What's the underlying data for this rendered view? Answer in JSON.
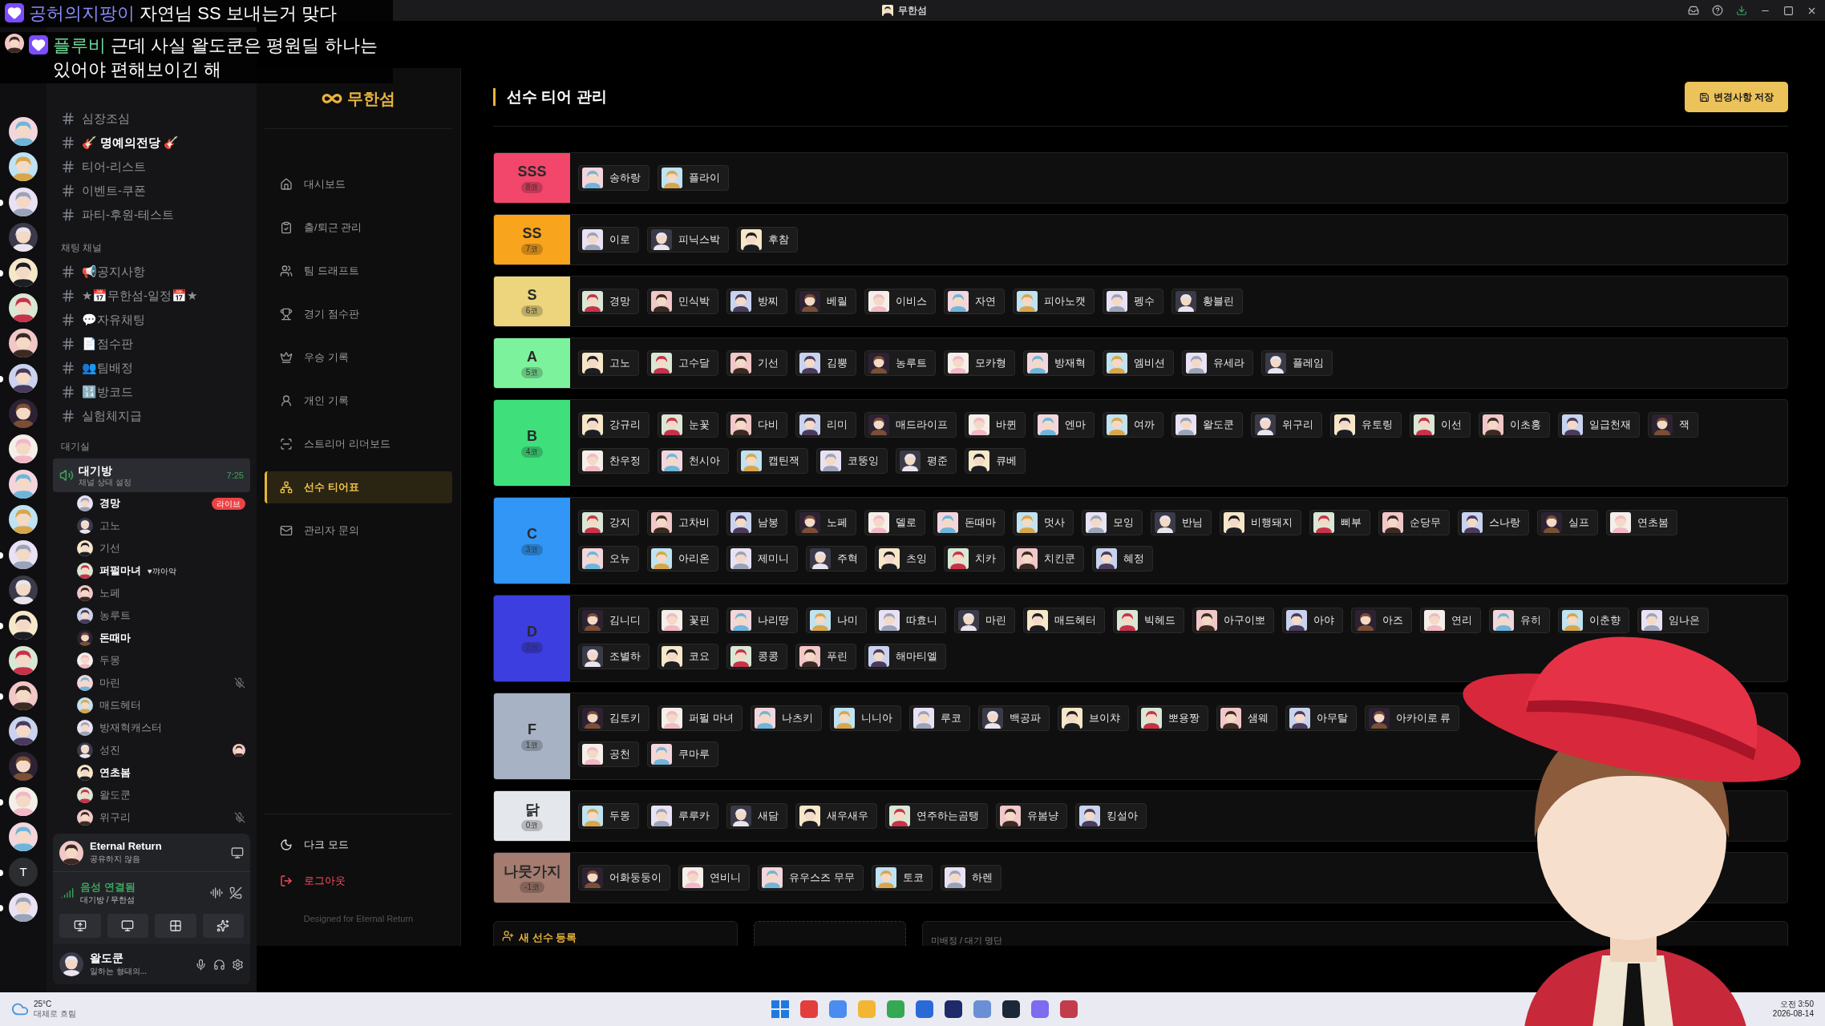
{
  "window": {
    "title": "무한섬"
  },
  "chat_overlay": [
    {
      "user": "공허의지팡이",
      "color": "#8c8cff",
      "text": "자연님 SS 보내는거 맞다",
      "avatar": false
    },
    {
      "user": "플루비",
      "color": "#6fdc9a",
      "text": "근데 사실 왈도쿤은 평원딜 하나는 있어야 편해보이긴 해",
      "avatar": true
    }
  ],
  "servers": [
    {
      "kind": "picture",
      "unread": false
    },
    {
      "kind": "picture",
      "unread": false
    },
    {
      "kind": "picture",
      "unread": true
    },
    {
      "kind": "picture",
      "unread": false
    },
    {
      "kind": "picture",
      "unread": true
    },
    {
      "kind": "picture",
      "unread": false
    },
    {
      "kind": "picture",
      "unread": false
    },
    {
      "kind": "picture",
      "unread": true
    },
    {
      "kind": "picture",
      "unread": false
    },
    {
      "kind": "picture",
      "unread": false
    },
    {
      "kind": "picture",
      "unread": false
    },
    {
      "kind": "picture",
      "unread": false
    },
    {
      "kind": "picture",
      "unread": true
    },
    {
      "kind": "picture",
      "unread": false
    },
    {
      "kind": "picture",
      "unread": true
    },
    {
      "kind": "picture",
      "unread": false
    },
    {
      "kind": "picture",
      "unread": true
    },
    {
      "kind": "picture",
      "unread": false
    },
    {
      "kind": "picture",
      "unread": false
    },
    {
      "kind": "picture",
      "unread": true
    },
    {
      "kind": "picture",
      "unread": false
    },
    {
      "kind": "text",
      "label": "T",
      "unread": true
    },
    {
      "kind": "picture",
      "unread": true
    }
  ],
  "discord": {
    "channels": [
      {
        "name": "심장조심",
        "unread": false
      },
      {
        "name": "🎸 명예의전당 🎸",
        "unread": true
      },
      {
        "name": "티어-리스트",
        "unread": false
      },
      {
        "name": "이벤트-쿠폰",
        "unread": false
      },
      {
        "name": "파티-후원-테스트",
        "unread": false
      }
    ],
    "categories": [
      {
        "name": "채팅 채널",
        "channels": [
          {
            "name": "📢공지사항",
            "unread": false
          },
          {
            "name": "★📅무한섬-일정📅★",
            "unread": false
          },
          {
            "name": "💬자유채팅",
            "unread": false
          },
          {
            "name": "📄점수판",
            "unread": false
          },
          {
            "name": "👥팀배정",
            "unread": false
          },
          {
            "name": "🔢방코드",
            "unread": false
          },
          {
            "name": "실험체지급",
            "unread": false
          }
        ]
      }
    ],
    "voice_category": "대기실",
    "voice_channel": {
      "name": "대기방",
      "status": "채널 상태 설정",
      "time": "7:25"
    },
    "members": [
      {
        "name": "경망",
        "speaking": true,
        "badge": "라이브",
        "muted": false,
        "activity": false
      },
      {
        "name": "고노",
        "speaking": false,
        "muted": false,
        "activity": false
      },
      {
        "name": "기선",
        "speaking": false,
        "muted": false,
        "activity": false
      },
      {
        "name": "퍼펄마녀",
        "speaking": true,
        "status": "♥꺄아악",
        "muted": false,
        "activity": false
      },
      {
        "name": "노페",
        "speaking": false,
        "muted": false,
        "activity": false
      },
      {
        "name": "농루트",
        "speaking": false,
        "muted": false,
        "activity": false
      },
      {
        "name": "돈때마",
        "speaking": true,
        "muted": false,
        "activity": false
      },
      {
        "name": "두몽",
        "speaking": false,
        "muted": false,
        "activity": false
      },
      {
        "name": "마린",
        "speaking": false,
        "muted": true,
        "activity": false
      },
      {
        "name": "매드헤터",
        "speaking": false,
        "muted": false,
        "activity": false
      },
      {
        "name": "방재혁캐스터",
        "speaking": false,
        "muted": false,
        "activity": false
      },
      {
        "name": "성진",
        "speaking": false,
        "muted": false,
        "activity": true
      },
      {
        "name": "연초봄",
        "speaking": true,
        "muted": false,
        "activity": false
      },
      {
        "name": "왈도쿤",
        "speaking": false,
        "muted": false,
        "activity": false
      },
      {
        "name": "위구리",
        "speaking": false,
        "muted": true,
        "activity": false
      }
    ],
    "activity": {
      "title": "Eternal Return",
      "subtitle": "공유하지 않음"
    },
    "voice_status": {
      "status": "음성 연결됨",
      "location": "대기방 / 무한섬"
    },
    "user": {
      "name": "왈도쿤",
      "status": "일하는 형태의..."
    }
  },
  "app": {
    "logo": "무한섬",
    "nav": [
      {
        "label": "대시보드",
        "selected": false
      },
      {
        "label": "출/퇴근 관리",
        "selected": false
      },
      {
        "label": "팀 드래프트",
        "selected": false
      },
      {
        "label": "경기 점수판",
        "selected": false
      },
      {
        "label": "우승 기록",
        "selected": false
      },
      {
        "label": "개인 기록",
        "selected": false
      },
      {
        "label": "스트리머 리더보드",
        "selected": false
      },
      {
        "label": "선수 티어표",
        "selected": true
      },
      {
        "label": "관리자 문의",
        "selected": false
      }
    ],
    "footer_nav": [
      {
        "label": "다크 모드",
        "kind": "theme"
      },
      {
        "label": "로그아웃",
        "kind": "logout"
      }
    ],
    "credit": "Designed for Eternal Return",
    "page_title": "선수 티어 관리",
    "save_button": "변경사항 저장",
    "tiers": [
      {
        "name": "SSS",
        "count": "8코",
        "color": "#f2476b",
        "lines": [
          [
            "송하랑",
            "플라이"
          ]
        ]
      },
      {
        "name": "SS",
        "count": "7코",
        "color": "#f8a41c",
        "lines": [
          [
            "이로",
            "피닉스박",
            "후참"
          ]
        ]
      },
      {
        "name": "S",
        "count": "6코",
        "color": "#ecd57c",
        "lines": [
          [
            "경망",
            "민식박",
            "방찌",
            "베릴",
            "이비스",
            "자연",
            "피아노캣",
            "펭수",
            "황블린"
          ]
        ]
      },
      {
        "name": "A",
        "count": "5코",
        "color": "#7df29c",
        "lines": [
          [
            "고노",
            "고수달",
            "기선",
            "김뿡",
            "농루트",
            "모카형",
            "방재혁",
            "엠비션",
            "유세라",
            "플레임"
          ]
        ]
      },
      {
        "name": "B",
        "count": "4코",
        "color": "#3fe07c",
        "lines": [
          [
            "강규리",
            "눈꽃",
            "다비",
            "리미",
            "매드라이프",
            "바퀸",
            "엔마",
            "여까",
            "왈도쿤",
            "위구리",
            "유토링",
            "이선",
            "이초홍",
            "일급천재",
            "잭"
          ],
          [
            "찬우정",
            "천시아",
            "캡틴잭",
            "코뚱잉",
            "평준",
            "큐베"
          ]
        ]
      },
      {
        "name": "C",
        "count": "3코",
        "color": "#3196f6",
        "lines": [
          [
            "강지",
            "고차비",
            "남봉",
            "노페",
            "델로",
            "돈때마",
            "멋사",
            "모잉",
            "반님",
            "비행돼지",
            "삐부",
            "순당무",
            "스나랑",
            "실프",
            "연초봄"
          ],
          [
            "오뉴",
            "아리온",
            "제미니",
            "주혁",
            "츠잉",
            "치카",
            "치킨쿤",
            "혜정"
          ]
        ]
      },
      {
        "name": "D",
        "count": "2코",
        "color": "#3c3ee0",
        "lines": [
          [
            "김니디",
            "꽃핀",
            "나리땅",
            "나미",
            "따효니",
            "마린",
            "매드헤터",
            "빅헤드",
            "아구이뽀",
            "아야",
            "아즈",
            "연리",
            "유히",
            "이춘향",
            "임나은"
          ],
          [
            "조별하",
            "코요",
            "콩콩",
            "푸린",
            "해마티엘"
          ]
        ]
      },
      {
        "name": "F",
        "count": "1코",
        "color": "#a7b2c5",
        "lines": [
          [
            "김토키",
            "퍼펄 마녀",
            "나츠키",
            "니니아",
            "루코",
            "백공파",
            "브이챠",
            "뽀용짱",
            "샘웨",
            "아무탈",
            "아카이로 류"
          ],
          [
            "공천",
            "쿠마루"
          ]
        ]
      },
      {
        "name": "닭",
        "count": "0코",
        "color": "#e4e7ec",
        "lines": [
          [
            "두몽",
            "루루카",
            "새담",
            "새우새우",
            "연주하는곰탱",
            "유봄냥",
            "킹설아"
          ]
        ]
      },
      {
        "name": "나뭇가지",
        "count": "-1코",
        "color": "#a47c70",
        "lines": [
          [
            "어화둥둥이",
            "연비니",
            "유우스즈 무무",
            "토코",
            "하렌"
          ]
        ]
      }
    ],
    "register_card": "새 선수 등록",
    "waiting_card": "미배정 / 대기 명단"
  },
  "taskbar": {
    "temperature": "25°C",
    "weather": "대체로 흐림",
    "time": "오전 3:50",
    "date": "2026-08-14"
  }
}
